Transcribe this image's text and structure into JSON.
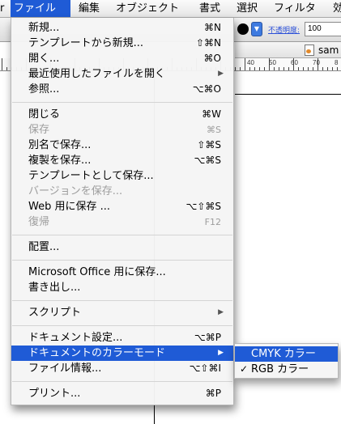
{
  "menubar": {
    "left_fragment": "r",
    "items": [
      {
        "label": "ファイル"
      },
      {
        "label": "編集"
      },
      {
        "label": "オブジェクト"
      },
      {
        "label": "書式"
      },
      {
        "label": "選択"
      },
      {
        "label": "フィルタ"
      },
      {
        "label": "効"
      }
    ]
  },
  "toolbar": {
    "opacity_label": "不透明度:",
    "opacity_value": "100"
  },
  "document": {
    "title": "sam"
  },
  "ruler": {
    "labels": [
      "40",
      "50",
      "60",
      "70",
      "8"
    ]
  },
  "file_menu": {
    "items": [
      {
        "label": "新規...",
        "shortcut": "⌘N"
      },
      {
        "label": "テンプレートから新規...",
        "shortcut": "⇧⌘N"
      },
      {
        "label": "開く...",
        "shortcut": "⌘O"
      },
      {
        "label": "最近使用したファイルを開く",
        "submenu": true
      },
      {
        "label": "参照...",
        "shortcut": "⌥⌘O"
      },
      {
        "separator": true
      },
      {
        "label": "閉じる",
        "shortcut": "⌘W"
      },
      {
        "label": "保存",
        "shortcut": "⌘S",
        "disabled": true
      },
      {
        "label": "別名で保存...",
        "shortcut": "⇧⌘S"
      },
      {
        "label": "複製を保存...",
        "shortcut": "⌥⌘S"
      },
      {
        "label": "テンプレートとして保存..."
      },
      {
        "label": "バージョンを保存...",
        "disabled": true
      },
      {
        "label": "Web 用に保存 ...",
        "shortcut": "⌥⇧⌘S"
      },
      {
        "label": "復帰",
        "shortcut": "F12",
        "disabled": true
      },
      {
        "separator": true
      },
      {
        "label": "配置..."
      },
      {
        "separator": true
      },
      {
        "label": "Microsoft Office 用に保存..."
      },
      {
        "label": "書き出し..."
      },
      {
        "separator": true
      },
      {
        "label": "スクリプト",
        "submenu": true
      },
      {
        "separator": true
      },
      {
        "label": "ドキュメント設定...",
        "shortcut": "⌥⌘P"
      },
      {
        "label": "ドキュメントのカラーモード",
        "submenu": true,
        "highlight": true
      },
      {
        "label": "ファイル情報...",
        "shortcut": "⌥⇧⌘I"
      },
      {
        "separator": true
      },
      {
        "label": "プリント...",
        "shortcut": "⌘P"
      }
    ]
  },
  "color_mode_submenu": {
    "items": [
      {
        "label": "CMYK カラー",
        "highlight": true,
        "checked": false
      },
      {
        "label": "RGB カラー",
        "highlight": false,
        "checked": true
      }
    ]
  },
  "colors": {
    "highlight": "#1f5bd6",
    "disabled_text": "#9d9d9d"
  }
}
